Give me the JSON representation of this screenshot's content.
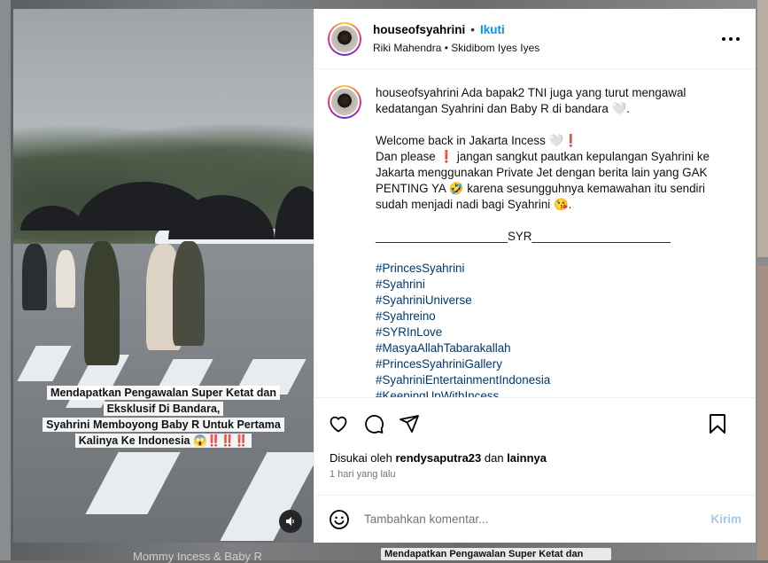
{
  "header": {
    "username": "houseofsyahrini",
    "separator": "•",
    "follow_label": "Ikuti",
    "audio_line": "Riki Mahendra • Skidibom Iyes Iyes"
  },
  "media": {
    "overlay_lines": [
      "Mendapatkan Pengawalan Super Ketat dan",
      "Eksklusif Di Bandara,",
      "Syahrini Memboyong Baby R Untuk Pertama",
      "Kalinya Ke Indonesia 😱‼️‼️‼️"
    ]
  },
  "caption": {
    "username": "houseofsyahrini",
    "para1": " Ada bapak2 TNI juga yang turut mengawal kedatangan Syahrini dan Baby R di bandara 🤍.",
    "para2": "Welcome back in Jakarta Incess 🤍❗",
    "para3": "Dan please ❗ jangan sangkut pautkan kepulangan Syahrini ke Jakarta menggunakan Private Jet dengan berita lain yang GAK PENTING YA 🤣 karena sesungguhnya kemawahan itu sendiri sudah menjadi nadi bagi Syahrini 😘.",
    "divider": "____________________SYR_____________________",
    "hashtags": [
      "#PrincesSyahrini",
      "#Syahrini",
      "#SyahriniUniverse",
      "#Syahreino",
      "#SYRInLove",
      "#MasyaAllahTabarakallah",
      "#PrincesSyahriniGallery",
      "#SyahriniEntertainmentIndonesia",
      "#KeepingUpWithIncess"
    ]
  },
  "likes": {
    "prefix": "Disukai oleh ",
    "user": "rendysaputra23",
    "middle": " dan ",
    "others": "lainnya"
  },
  "timestamp": "1 hari yang lalu",
  "comment": {
    "placeholder": "Tambahkan komentar...",
    "post_label": "Kirim"
  },
  "background": {
    "caption_left": "Mommy Incess & Baby R",
    "caption_right": "Mendapatkan Pengawalan Super Ketat dan"
  },
  "icons": [
    "heart-icon",
    "comment-icon",
    "share-icon",
    "bookmark-icon",
    "emoji-icon",
    "more-icon",
    "speaker-icon"
  ]
}
